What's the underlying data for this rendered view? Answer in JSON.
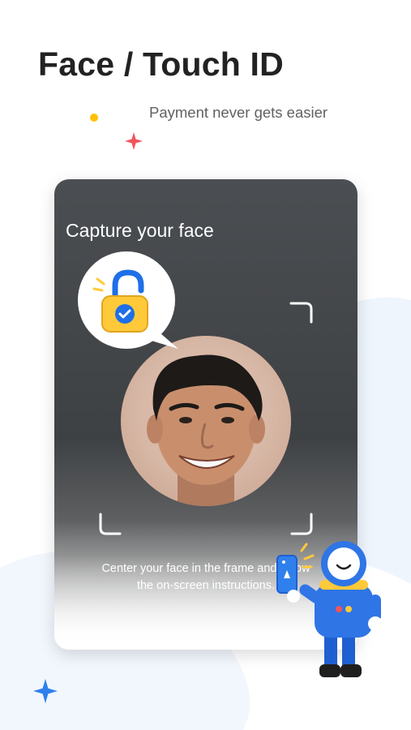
{
  "header": {
    "title": "Face / Touch ID",
    "subtitle": "Payment never gets easier"
  },
  "card": {
    "title": "Capture your face",
    "instruction_line1": "Center your face in the frame and follow",
    "instruction_line2": "the on-screen instructions."
  },
  "colors": {
    "accent_blue": "#1E6FE8",
    "lock_yellow": "#FFC93A",
    "spark_red": "#F2545B",
    "spark_blue": "#2F80ED",
    "dot_yellow": "#FFC107"
  },
  "icons": [
    "lock-icon",
    "face-frame-corner-icon",
    "sparkle-icon",
    "astronaut-illustration"
  ]
}
